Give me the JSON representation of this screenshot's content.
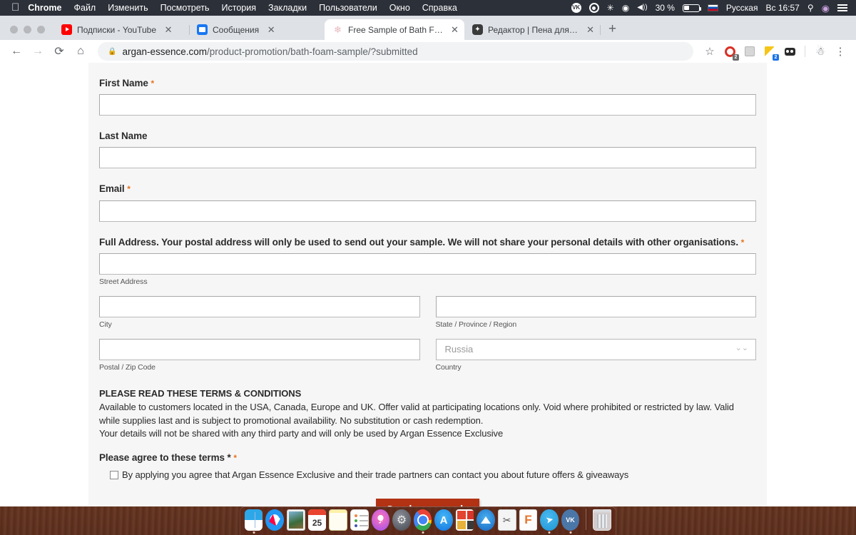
{
  "menubar": {
    "apple_icon": "apple-icon",
    "items": [
      {
        "label": "Chrome",
        "bold": true
      },
      {
        "label": "Файл",
        "bold": false
      },
      {
        "label": "Изменить",
        "bold": false
      },
      {
        "label": "Посмотреть",
        "bold": false
      },
      {
        "label": "История",
        "bold": false
      },
      {
        "label": "Закладки",
        "bold": false
      },
      {
        "label": "Пользователи",
        "bold": false
      },
      {
        "label": "Окно",
        "bold": false
      },
      {
        "label": "Справка",
        "bold": false
      }
    ],
    "status": {
      "vk_icon": "vk-icon",
      "record_icon": "record-icon",
      "bluetooth_icon": "bluetooth-icon",
      "bluetooth_glyph": "✳",
      "wifi_icon": "wifi-icon",
      "wifi_glyph": "◤",
      "volume_icon": "volume-icon",
      "volume_glyph": "◀))",
      "battery_percent": "30 %",
      "battery_icon": "battery-icon",
      "flag_icon": "russian-flag-icon",
      "keyboard_layout": "Русская",
      "clock": "Вс 16:57",
      "search_icon": "spotlight-search-icon",
      "search_glyph": "🔍",
      "siri_icon": "siri-icon",
      "notifications_icon": "notification-center-icon"
    }
  },
  "browser": {
    "window_controls": [
      "close",
      "minimize",
      "maximize"
    ],
    "tabs": [
      {
        "title": "Подписки - YouTube",
        "favicon": "youtube-icon",
        "active": false,
        "close_glyph": "✕"
      },
      {
        "title": "Сообщения",
        "favicon": "messages-icon",
        "active": false,
        "close_glyph": "✕"
      },
      {
        "title": "Free Sample of Bath Foam – ",
        "title_fade": "Ar",
        "favicon": "flower-icon",
        "active": true,
        "close_glyph": "✕"
      },
      {
        "title": "Редактор | Пена для ванны | ",
        "title_fade": "Э",
        "favicon": "editor-icon",
        "active": false,
        "close_glyph": "✕"
      }
    ],
    "new_tab_glyph": "+",
    "nav": {
      "back_glyph": "←",
      "forward_glyph": "→",
      "reload_glyph": "⟳",
      "home_glyph": "⌂"
    },
    "omnibox": {
      "lock_glyph": "🔒",
      "host": "argan-essence.com",
      "path": "/product-promotion/bath-foam-sample/?submitted"
    },
    "toolbar_icons": [
      {
        "name": "bookmark-star-icon",
        "glyph": "☆",
        "badge": ""
      },
      {
        "name": "extension-adblock-icon",
        "glyph": "",
        "badge": "2"
      },
      {
        "name": "extension-screenshot-icon",
        "glyph": "",
        "badge": ""
      },
      {
        "name": "extension-notes-icon",
        "glyph": "",
        "badge": "2"
      },
      {
        "name": "extension-dark-icon",
        "glyph": "",
        "badge": ""
      },
      {
        "name": "profile-avatar-icon",
        "glyph": "",
        "badge": ""
      },
      {
        "name": "chrome-menu-icon",
        "glyph": "⋮",
        "badge": ""
      }
    ]
  },
  "form": {
    "first_name": {
      "label": "First Name",
      "required": true,
      "required_glyph": "*",
      "value": "",
      "placeholder": ""
    },
    "last_name": {
      "label": "Last Name",
      "required": false,
      "required_glyph": "",
      "value": "",
      "placeholder": ""
    },
    "email": {
      "label": "Email",
      "required": true,
      "required_glyph": "*",
      "value": "",
      "placeholder": ""
    },
    "address": {
      "label": "Full Address. Your postal address will only be used to send out your sample. We will not share your personal details with other organisations.",
      "required": true,
      "required_glyph": "*",
      "street": {
        "sub_label": "Street Address",
        "value": ""
      },
      "city": {
        "sub_label": "City",
        "value": ""
      },
      "state": {
        "sub_label": "State / Province / Region",
        "value": ""
      },
      "postal": {
        "sub_label": "Postal / Zip Code",
        "value": ""
      },
      "country": {
        "sub_label": "Country",
        "value": "Russia",
        "chevron_glyph": "⌄⌄"
      }
    },
    "terms": {
      "heading": "PLEASE READ THESE TERMS & CONDITIONS",
      "body": "Available to customers located in the USA, Canada, Europe and UK. Offer valid at participating locations only. Void where prohibited or restricted by law. Valid while supplies last and is subject to promotional availability. No substitution or cash redemption.",
      "privacy": "Your details will not be shared with any third party and will only be used by Argan Essence Exclusive"
    },
    "agree": {
      "label": "Please agree to these terms *",
      "required_glyph": "*",
      "checkbox_text": "By applying you agree that Argan Essence Exclusive and their trade partners can contact you about future offers & giveaways",
      "checked": false
    },
    "submit_label": "Send my sample",
    "submit_color": "#b23213",
    "required_color": "#e8731e"
  },
  "dock": {
    "items": [
      {
        "name": "finder",
        "class": "d-finder",
        "running": true,
        "text": ""
      },
      {
        "name": "safari",
        "class": "d-safari",
        "running": false,
        "text": ""
      },
      {
        "name": "preview",
        "class": "d-preview",
        "running": false,
        "text": ""
      },
      {
        "name": "calendar",
        "class": "d-cal",
        "running": false,
        "text": "25"
      },
      {
        "name": "notes",
        "class": "d-notes",
        "running": false,
        "text": ""
      },
      {
        "name": "reminders",
        "class": "d-rem",
        "running": false,
        "text": ""
      },
      {
        "name": "itunes",
        "class": "d-itunes",
        "running": false,
        "text": ""
      },
      {
        "name": "system-preferences",
        "class": "d-sysprefs",
        "running": false,
        "text": ""
      },
      {
        "name": "google-chrome",
        "class": "d-chrome",
        "running": true,
        "text": ""
      },
      {
        "name": "app-store",
        "class": "d-appstore",
        "running": false,
        "text": ""
      },
      {
        "name": "photos",
        "class": "d-photos",
        "running": false,
        "text": ""
      },
      {
        "name": "cleanmymac",
        "class": "d-cmm",
        "running": false,
        "text": ""
      },
      {
        "name": "snipping-tool",
        "class": "d-snip",
        "running": false,
        "text": ""
      },
      {
        "name": "fusion-360",
        "class": "d-fusion",
        "running": false,
        "text": ""
      },
      {
        "name": "telegram",
        "class": "d-tg",
        "running": true,
        "text": ""
      },
      {
        "name": "vk",
        "class": "d-vk",
        "running": true,
        "text": ""
      }
    ],
    "trash": {
      "name": "trash",
      "class": "d-trash"
    }
  }
}
